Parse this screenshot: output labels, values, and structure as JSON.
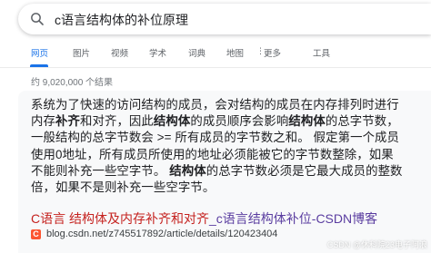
{
  "search": {
    "query": "c语言结构体的补位原理"
  },
  "tabs": [
    {
      "label": "网页"
    },
    {
      "label": "图片"
    },
    {
      "label": "视频"
    },
    {
      "label": "学术"
    },
    {
      "label": "词典"
    },
    {
      "label": "地图"
    },
    {
      "label": "更多"
    },
    {
      "label": "工具"
    }
  ],
  "results": {
    "count": "约 9,020,000 个结果"
  },
  "snippet": {
    "part1": "系统为了快速的访问结构的成员，会对结构的成员在内存排列时进行内存",
    "bold1": "补齐",
    "part2": "和对齐，因此",
    "bold2": "结构体",
    "part3": "的成员顺序会影响",
    "bold3": "结构体",
    "part4": "的总字节数，一般结构的总字节数会 >= 所有成员的字节数之和。 假定第一个成员使用0地址，所有成员所使用的地址必须能被它的字节数整除，如果不能则补充一些空字节。 ",
    "bold4": "结构体",
    "part5": "的总字节数必须是它最大成员的整数倍，如果不是则补充一些空字节。"
  },
  "result": {
    "title_prefix": "C语言 ",
    "title_bold": "结构体及内存补齐和对齐",
    "title_suffix": "_c语言结构体补位-CSDN博客",
    "favicon_letter": "C",
    "url": "blog.csdn.net/z745517892/article/details/120423404"
  },
  "watermark": "CSDN @休科院23电子阿浪",
  "colors": {
    "accent": "#1a73e8",
    "title_red": "#c5221f",
    "title_purple": "#5a3da0",
    "csdn": "#fc5531"
  }
}
